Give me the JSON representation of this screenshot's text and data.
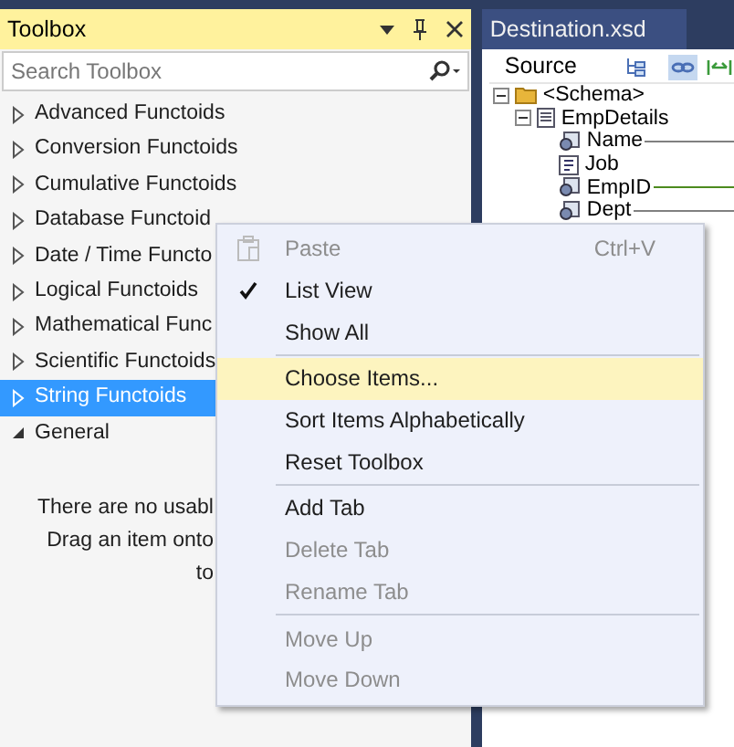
{
  "toolbox": {
    "title": "Toolbox",
    "search": {
      "placeholder": "Search Toolbox"
    },
    "categories": [
      {
        "label": "Advanced Functoids",
        "selected": false,
        "expanded": false
      },
      {
        "label": "Conversion Functoids",
        "selected": false,
        "expanded": false
      },
      {
        "label": "Cumulative Functoids",
        "selected": false,
        "expanded": false
      },
      {
        "label": "Database Functoid",
        "selected": false,
        "expanded": false
      },
      {
        "label": "Date / Time Functo",
        "selected": false,
        "expanded": false
      },
      {
        "label": "Logical Functoids",
        "selected": false,
        "expanded": false
      },
      {
        "label": "Mathematical Func",
        "selected": false,
        "expanded": false
      },
      {
        "label": "Scientific Functoids",
        "selected": false,
        "expanded": false
      },
      {
        "label": "String Functoids",
        "selected": true,
        "expanded": false
      },
      {
        "label": "General",
        "selected": false,
        "expanded": true
      }
    ],
    "message": [
      "There are no usabl",
      "Drag an item onto",
      "to"
    ]
  },
  "destination": {
    "title": "Destination.xsd",
    "tab": "Source",
    "tree": [
      {
        "label": "<Schema>",
        "kind": "folder",
        "children": [
          {
            "label": "EmpDetails",
            "kind": "record",
            "children": [
              {
                "label": "Name",
                "kind": "field",
                "color": "#808080"
              },
              {
                "label": "Job",
                "kind": "attribute"
              },
              {
                "label": "EmpID",
                "kind": "field",
                "color": "#4c8a1e"
              },
              {
                "label": "Dept",
                "kind": "field",
                "color": "#808080"
              }
            ]
          }
        ]
      }
    ]
  },
  "context_menu": [
    {
      "kind": "item",
      "label": "Paste",
      "shortcut": "Ctrl+V",
      "disabled": true,
      "checked": false,
      "selected": false,
      "icon": true
    },
    {
      "kind": "item",
      "label": "List View",
      "disabled": false,
      "checked": true,
      "selected": false
    },
    {
      "kind": "item",
      "label": "Show All",
      "disabled": false,
      "checked": false,
      "selected": false
    },
    {
      "kind": "separator"
    },
    {
      "kind": "item",
      "label": "Choose Items...",
      "disabled": false,
      "checked": false,
      "selected": true
    },
    {
      "kind": "item",
      "label": "Sort Items Alphabetically",
      "disabled": false,
      "checked": false,
      "selected": false
    },
    {
      "kind": "item",
      "label": "Reset Toolbox",
      "disabled": false,
      "checked": false,
      "selected": false
    },
    {
      "kind": "separator"
    },
    {
      "kind": "item",
      "label": "Add Tab",
      "disabled": false,
      "checked": false,
      "selected": false
    },
    {
      "kind": "item",
      "label": "Delete Tab",
      "disabled": true,
      "checked": false,
      "selected": false
    },
    {
      "kind": "item",
      "label": "Rename Tab",
      "disabled": true,
      "checked": false,
      "selected": false
    },
    {
      "kind": "separator"
    },
    {
      "kind": "item",
      "label": "Move Up",
      "disabled": true,
      "checked": false,
      "selected": false
    },
    {
      "kind": "item",
      "label": "Move Down",
      "disabled": true,
      "checked": false,
      "selected": false
    }
  ]
}
